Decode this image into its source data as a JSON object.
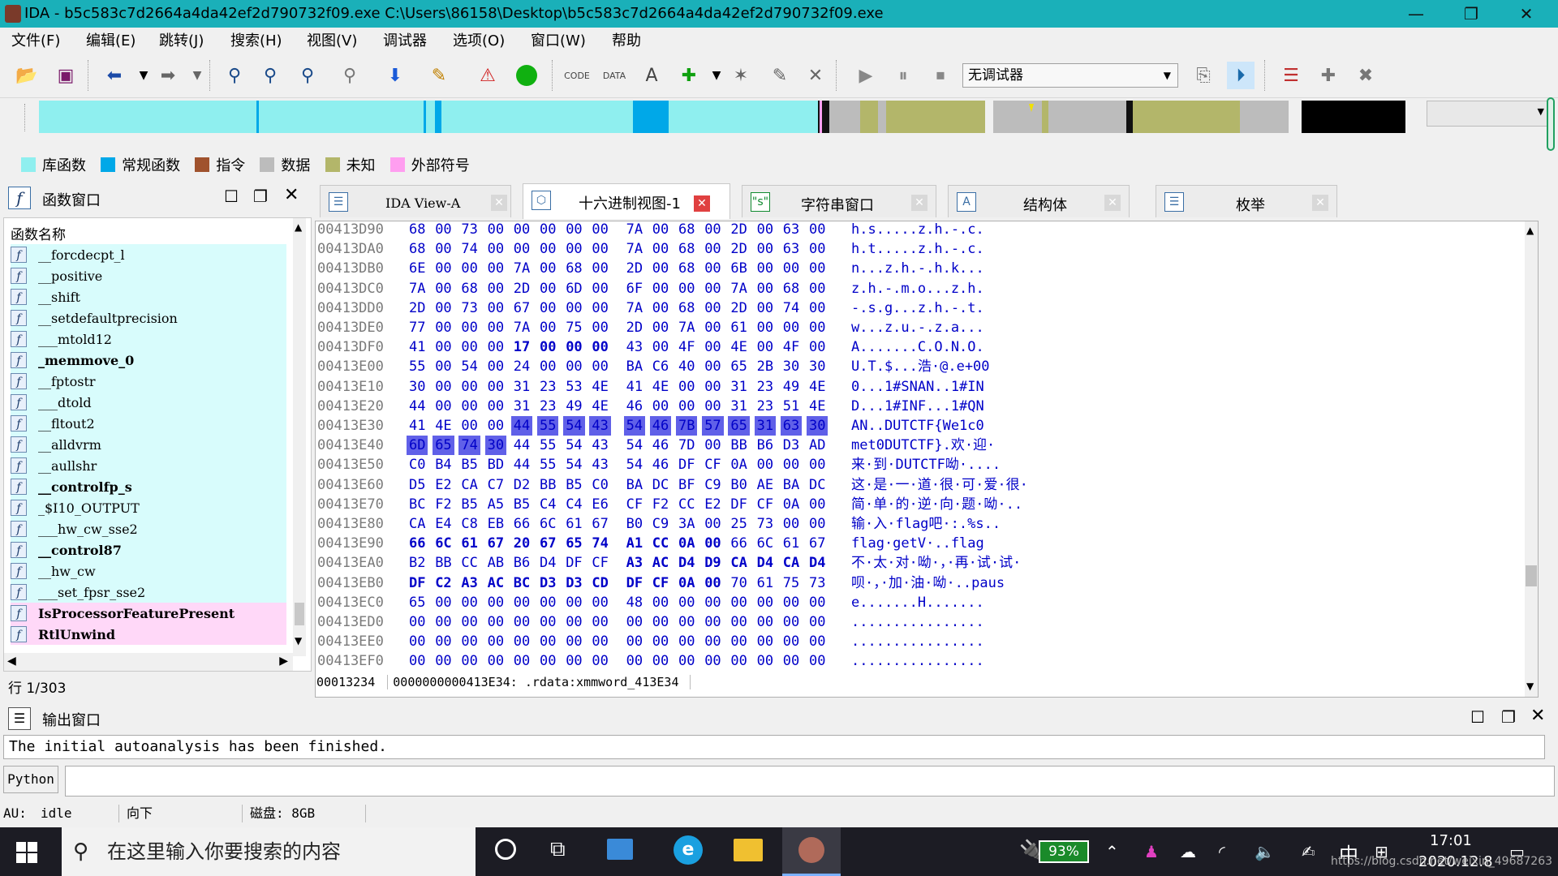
{
  "window": {
    "title": "IDA - b5c583c7d2664a4da42ef2d790732f09.exe C:\\Users\\86158\\Desktop\\b5c583c7d2664a4da42ef2d790732f09.exe",
    "minimize": "—",
    "maximize": "❐",
    "close": "✕"
  },
  "menu": [
    "文件(F)",
    "编辑(E)",
    "跳转(J)",
    "搜索(H)",
    "视图(V)",
    "调试器",
    "选项(O)",
    "窗口(W)",
    "帮助"
  ],
  "toolbar": {
    "debugger_selected": "无调试器"
  },
  "legend": [
    {
      "label": "库函数",
      "color": "#8fefef"
    },
    {
      "label": "常规函数",
      "color": "#00a8e8"
    },
    {
      "label": "指令",
      "color": "#a0522d"
    },
    {
      "label": "数据",
      "color": "#bcbcbc"
    },
    {
      "label": "未知",
      "color": "#b3b66a"
    },
    {
      "label": "外部符号",
      "color": "#ff9ef0"
    }
  ],
  "functions_panel": {
    "title": "函数窗口",
    "column_header": "函数名称",
    "line_status": "行 1/303",
    "items": [
      {
        "name": "__forcdecpt_l",
        "bold": false,
        "bg": "lib"
      },
      {
        "name": "__positive",
        "bold": false,
        "bg": "lib"
      },
      {
        "name": "__shift",
        "bold": false,
        "bg": "lib"
      },
      {
        "name": "__setdefaultprecision",
        "bold": false,
        "bg": "lib"
      },
      {
        "name": "___mtold12",
        "bold": false,
        "bg": "lib"
      },
      {
        "name": "_memmove_0",
        "bold": true,
        "bg": "lib"
      },
      {
        "name": "__fptostr",
        "bold": false,
        "bg": "lib"
      },
      {
        "name": "___dtold",
        "bold": false,
        "bg": "lib"
      },
      {
        "name": "__fltout2",
        "bold": false,
        "bg": "lib"
      },
      {
        "name": "__alldvrm",
        "bold": false,
        "bg": "lib"
      },
      {
        "name": "__aullshr",
        "bold": false,
        "bg": "lib"
      },
      {
        "name": "__controlfp_s",
        "bold": true,
        "bg": "lib"
      },
      {
        "name": "_$I10_OUTPUT",
        "bold": false,
        "bg": "lib"
      },
      {
        "name": "___hw_cw_sse2",
        "bold": false,
        "bg": "lib"
      },
      {
        "name": "__control87",
        "bold": true,
        "bg": "lib"
      },
      {
        "name": "__hw_cw",
        "bold": false,
        "bg": "lib"
      },
      {
        "name": "___set_fpsr_sse2",
        "bold": false,
        "bg": "lib"
      },
      {
        "name": "IsProcessorFeaturePresent",
        "bold": true,
        "bg": "ext"
      },
      {
        "name": "RtlUnwind",
        "bold": true,
        "bg": "ext"
      }
    ]
  },
  "tabs": [
    {
      "label": "IDA View-A",
      "active": false
    },
    {
      "label": "十六进制视图-1",
      "active": true
    },
    {
      "label": "字符串窗口",
      "active": false
    },
    {
      "label": "结构体",
      "active": false
    },
    {
      "label": "枚举",
      "active": false
    }
  ],
  "hex": {
    "rows": [
      {
        "addr": "00413D90",
        "bytes": [
          "68",
          "00",
          "73",
          "00",
          "00",
          "00",
          "00",
          "00",
          "7A",
          "00",
          "68",
          "00",
          "2D",
          "00",
          "63",
          "00"
        ],
        "ascii": "h.s.....z.h.-.c."
      },
      {
        "addr": "00413DA0",
        "bytes": [
          "68",
          "00",
          "74",
          "00",
          "00",
          "00",
          "00",
          "00",
          "7A",
          "00",
          "68",
          "00",
          "2D",
          "00",
          "63",
          "00"
        ],
        "ascii": "h.t.....z.h.-.c."
      },
      {
        "addr": "00413DB0",
        "bytes": [
          "6E",
          "00",
          "00",
          "00",
          "7A",
          "00",
          "68",
          "00",
          "2D",
          "00",
          "68",
          "00",
          "6B",
          "00",
          "00",
          "00"
        ],
        "ascii": "n...z.h.-.h.k..."
      },
      {
        "addr": "00413DC0",
        "bytes": [
          "7A",
          "00",
          "68",
          "00",
          "2D",
          "00",
          "6D",
          "00",
          "6F",
          "00",
          "00",
          "00",
          "7A",
          "00",
          "68",
          "00"
        ],
        "ascii": "z.h.-.m.o...z.h."
      },
      {
        "addr": "00413DD0",
        "bytes": [
          "2D",
          "00",
          "73",
          "00",
          "67",
          "00",
          "00",
          "00",
          "7A",
          "00",
          "68",
          "00",
          "2D",
          "00",
          "74",
          "00"
        ],
        "ascii": "-.s.g...z.h.-.t."
      },
      {
        "addr": "00413DE0",
        "bytes": [
          "77",
          "00",
          "00",
          "00",
          "7A",
          "00",
          "75",
          "00",
          "2D",
          "00",
          "7A",
          "00",
          "61",
          "00",
          "00",
          "00"
        ],
        "ascii": "w...z.u.-.z.a..."
      },
      {
        "addr": "00413DF0",
        "bytes": [
          "41",
          "00",
          "00",
          "00",
          "17",
          "00",
          "00",
          "00",
          "43",
          "00",
          "4F",
          "00",
          "4E",
          "00",
          "4F",
          "00"
        ],
        "ascii": "A.......C.O.N.O.",
        "bold": [
          4,
          5,
          6,
          7
        ]
      },
      {
        "addr": "00413E00",
        "bytes": [
          "55",
          "00",
          "54",
          "00",
          "24",
          "00",
          "00",
          "00",
          "BA",
          "C6",
          "40",
          "00",
          "65",
          "2B",
          "30",
          "30"
        ],
        "ascii": "U.T.$...浩·@.e+00"
      },
      {
        "addr": "00413E10",
        "bytes": [
          "30",
          "00",
          "00",
          "00",
          "31",
          "23",
          "53",
          "4E",
          "41",
          "4E",
          "00",
          "00",
          "31",
          "23",
          "49",
          "4E"
        ],
        "ascii": "0...1#SNAN..1#IN"
      },
      {
        "addr": "00413E20",
        "bytes": [
          "44",
          "00",
          "00",
          "00",
          "31",
          "23",
          "49",
          "4E",
          "46",
          "00",
          "00",
          "00",
          "31",
          "23",
          "51",
          "4E"
        ],
        "ascii": "D...1#INF...1#QN"
      },
      {
        "addr": "00413E30",
        "bytes": [
          "41",
          "4E",
          "00",
          "00",
          "44",
          "55",
          "54",
          "43",
          "54",
          "46",
          "7B",
          "57",
          "65",
          "31",
          "63",
          "30"
        ],
        "ascii": "AN..DUTCTF{We1c0",
        "sel": [
          4,
          5,
          6,
          7,
          8,
          9,
          10,
          11,
          12,
          13,
          14,
          15
        ]
      },
      {
        "addr": "00413E40",
        "bytes": [
          "6D",
          "65",
          "74",
          "30",
          "44",
          "55",
          "54",
          "43",
          "54",
          "46",
          "7D",
          "00",
          "BB",
          "B6",
          "D3",
          "AD"
        ],
        "ascii": "met0DUTCTF}.欢·迎·",
        "sel": [
          0,
          1,
          2,
          3
        ]
      },
      {
        "addr": "00413E50",
        "bytes": [
          "C0",
          "B4",
          "B5",
          "BD",
          "44",
          "55",
          "54",
          "43",
          "54",
          "46",
          "DF",
          "CF",
          "0A",
          "00",
          "00",
          "00"
        ],
        "ascii": "来·到·DUTCTF呦·...."
      },
      {
        "addr": "00413E60",
        "bytes": [
          "D5",
          "E2",
          "CA",
          "C7",
          "D2",
          "BB",
          "B5",
          "C0",
          "BA",
          "DC",
          "BF",
          "C9",
          "B0",
          "AE",
          "BA",
          "DC"
        ],
        "ascii": "这·是·一·道·很·可·爱·很·"
      },
      {
        "addr": "00413E70",
        "bytes": [
          "BC",
          "F2",
          "B5",
          "A5",
          "B5",
          "C4",
          "C4",
          "E6",
          "CF",
          "F2",
          "CC",
          "E2",
          "DF",
          "CF",
          "0A",
          "00"
        ],
        "ascii": "简·单·的·逆·向·题·呦·.."
      },
      {
        "addr": "00413E80",
        "bytes": [
          "CA",
          "E4",
          "C8",
          "EB",
          "66",
          "6C",
          "61",
          "67",
          "B0",
          "C9",
          "3A",
          "00",
          "25",
          "73",
          "00",
          "00"
        ],
        "ascii": "输·入·flag吧·:.%s.."
      },
      {
        "addr": "00413E90",
        "bytes": [
          "66",
          "6C",
          "61",
          "67",
          "20",
          "67",
          "65",
          "74",
          "A1",
          "CC",
          "0A",
          "00",
          "66",
          "6C",
          "61",
          "67"
        ],
        "ascii": "flag·getV·..flag",
        "bold": [
          0,
          1,
          2,
          3,
          4,
          5,
          6,
          7,
          8,
          9,
          10,
          11
        ]
      },
      {
        "addr": "00413EA0",
        "bytes": [
          "B2",
          "BB",
          "CC",
          "AB",
          "B6",
          "D4",
          "DF",
          "CF",
          "A3",
          "AC",
          "D4",
          "D9",
          "CA",
          "D4",
          "CA",
          "D4"
        ],
        "ascii": "不·太·对·呦·，·再·试·试·",
        "bold": [
          8,
          9,
          10,
          11,
          12,
          13,
          14,
          15
        ]
      },
      {
        "addr": "00413EB0",
        "bytes": [
          "DF",
          "C2",
          "A3",
          "AC",
          "BC",
          "D3",
          "D3",
          "CD",
          "DF",
          "CF",
          "0A",
          "00",
          "70",
          "61",
          "75",
          "73"
        ],
        "ascii": "呗·，·加·油·呦·..paus",
        "bold": [
          0,
          1,
          2,
          3,
          4,
          5,
          6,
          7,
          8,
          9,
          10,
          11
        ]
      },
      {
        "addr": "00413EC0",
        "bytes": [
          "65",
          "00",
          "00",
          "00",
          "00",
          "00",
          "00",
          "00",
          "48",
          "00",
          "00",
          "00",
          "00",
          "00",
          "00",
          "00"
        ],
        "ascii": "e.......H......."
      },
      {
        "addr": "00413ED0",
        "bytes": [
          "00",
          "00",
          "00",
          "00",
          "00",
          "00",
          "00",
          "00",
          "00",
          "00",
          "00",
          "00",
          "00",
          "00",
          "00",
          "00"
        ],
        "ascii": "................"
      },
      {
        "addr": "00413EE0",
        "bytes": [
          "00",
          "00",
          "00",
          "00",
          "00",
          "00",
          "00",
          "00",
          "00",
          "00",
          "00",
          "00",
          "00",
          "00",
          "00",
          "00"
        ],
        "ascii": "................"
      },
      {
        "addr": "00413EF0",
        "bytes": [
          "00",
          "00",
          "00",
          "00",
          "00",
          "00",
          "00",
          "00",
          "00",
          "00",
          "00",
          "00",
          "00",
          "00",
          "00",
          "00"
        ],
        "ascii": "................"
      }
    ],
    "status_offset": "00013234",
    "status_location": "0000000000413E34: .rdata:xmmword_413E34"
  },
  "output": {
    "title": "输出窗口",
    "message": "The initial autoanalysis has been finished.",
    "python_label": "Python"
  },
  "status": {
    "au_label": "AU:",
    "au_state": "idle",
    "direction": "向下",
    "disk": "磁盘: 8GB"
  },
  "taskbar": {
    "search_placeholder": "在这里输入你要搜索的内容",
    "battery": "93%",
    "ime": "中",
    "time": "17:01",
    "date": "2020.12.8",
    "watermark": "https://blog.csdn.net/weixin_49687263"
  }
}
